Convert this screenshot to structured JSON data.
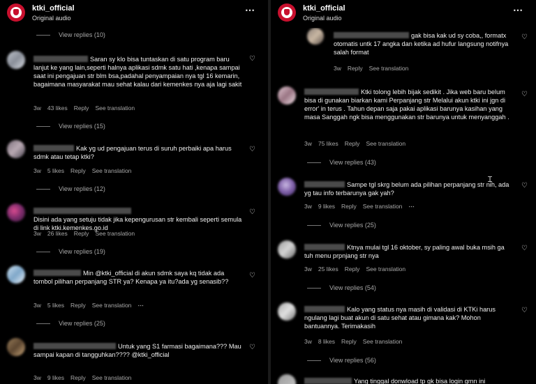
{
  "header": {
    "account_name": "ktki_official",
    "audio_label": "Original audio",
    "more_icon": "⋯"
  },
  "labels": {
    "view_replies_prefix": "View replies",
    "like": "Like",
    "reply": "Reply",
    "see_translation": "See translation"
  },
  "left_panel": {
    "top_view_replies": "View replies (10)",
    "comments": [
      {
        "text": "Saran sy klo bisa tuntaskan di satu program baru lanjut ke yang lain,seperti halnya aplikasi sdmk satu hati ,kenapa sampai saat ini pengajuan str blm bsa,padahal penyampaian nya tgl 16 kemarin, bagaimana masyarakat mau sehat kalau dari kemenkes nya aja lagi sakit",
        "time": "3w",
        "likes": "43 likes",
        "reply": "Reply",
        "translation": "See translation",
        "view_replies": "View replies (15)"
      },
      {
        "text": "Kak yg ud pengajuan terus di suruh perbaiki apa harus sdmk atau tetap ktki?",
        "time": "3w",
        "likes": "5 likes",
        "reply": "Reply",
        "translation": "See translation",
        "view_replies": "View replies (12)"
      },
      {
        "text": "Disini ada yang setuju tidak jika kepengurusan str kembali seperti semula di link ktki.kemenkes.go.id",
        "time": "3w",
        "likes": "26 likes",
        "reply": "Reply",
        "translation": "See translation",
        "view_replies": "View replies (19)"
      },
      {
        "text": "Min @ktki_official di akun sdmk saya kq tidak ada tombol pilihan perpanjang STR ya? Kenapa ya itu?ada yg senasib??",
        "time": "3w",
        "likes": "5 likes",
        "reply": "Reply",
        "translation": "See translation",
        "view_replies": "View replies (25)"
      },
      {
        "text": "Untuk yang S1 farmasi bagaimana??? Mau sampai kapan di tangguhkan???? @ktki_official",
        "time": "3w",
        "likes": "9 likes",
        "reply": "Reply",
        "translation": "See translation"
      }
    ]
  },
  "right_panel": {
    "comments": [
      {
        "text": "gak bisa kak ud sy coba,, formatx otomatis untk 17 angka dan ketika ad hufur langsung notifnya salah format",
        "time": "3w",
        "reply": "Reply",
        "translation": "See translation"
      },
      {
        "text": "Ktki tolong lebih bijak sedikit . Jika web baru belum bisa di gunakan biarkan kami Perpanjang str Melalui akun ktki ini jgn di error' in terus . Tahun depan saja pakai aplikasi barunya kasihan yang masa Sanggah ngk bisa menggunakan str barunya untuk menyanggah .",
        "time": "3w",
        "likes": "75 likes",
        "reply": "Reply",
        "translation": "See translation",
        "view_replies": "View replies (43)"
      },
      {
        "text": "Sampe tgl skrg belum ada pilihan perpanjang str nih, ada yg tau info terbarunya gak yah?",
        "time": "3w",
        "likes": "9 likes",
        "reply": "Reply",
        "translation": "See translation",
        "view_replies": "View replies (25)"
      },
      {
        "text": "Ktnya mulai tgl 16 oktober, sy paling awal buka msih ga tuh menu prpnjang str nya",
        "time": "3w",
        "likes": "25 likes",
        "reply": "Reply",
        "translation": "See translation",
        "view_replies": "View replies (54)"
      },
      {
        "text": "Kalo yang status nya masih di validasi di KTKi harus ngulang lagi buat akun di satu sehat atau gimana kak? Mohon bantuannya. Terimakasih",
        "time": "3w",
        "likes": "8 likes",
        "reply": "Reply",
        "translation": "See translation",
        "view_replies": "View replies (56)"
      },
      {
        "text": "Yang tinggal donwload tp gk bisa login gmn ini"
      }
    ]
  },
  "colors": {
    "background": "#000000",
    "text": "#f5f5f5",
    "muted": "#a8a8a8",
    "brand_red": "#c8102e"
  }
}
